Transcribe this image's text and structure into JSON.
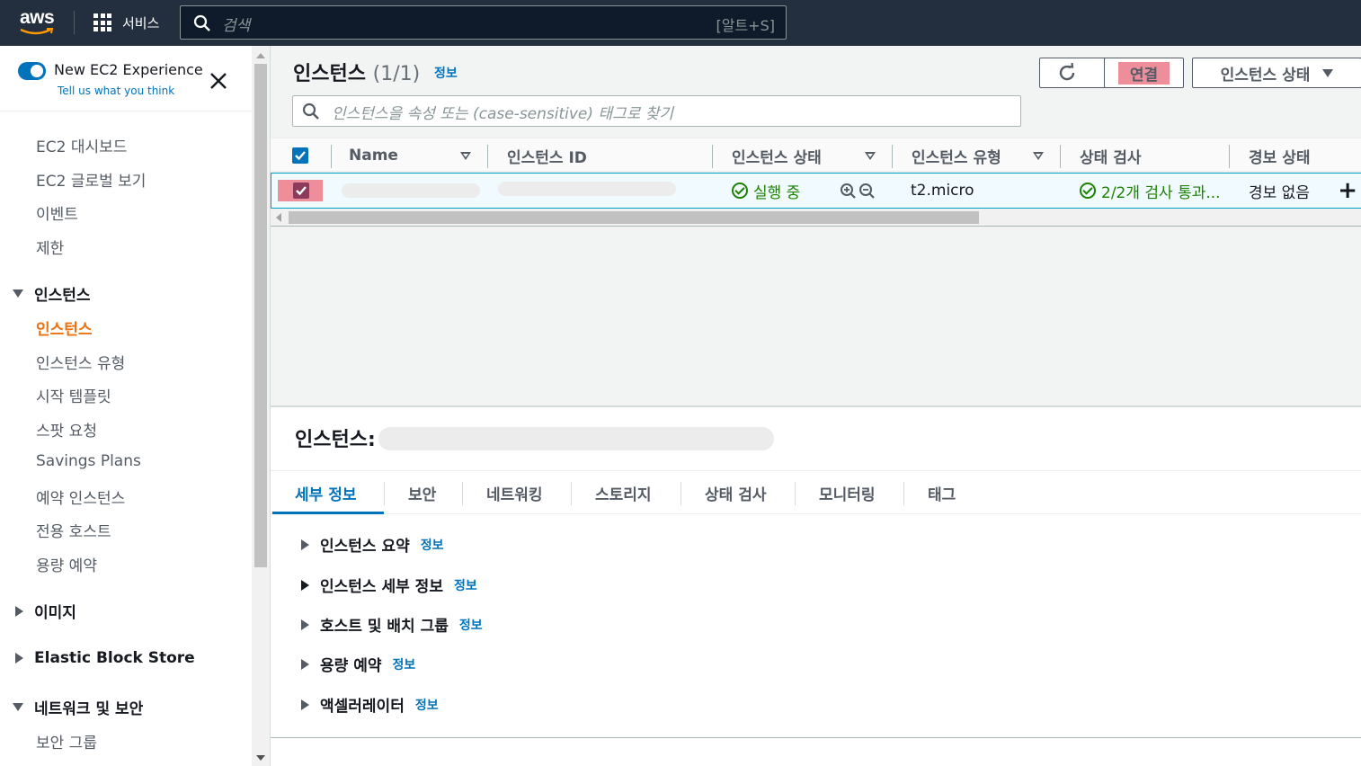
{
  "topnav": {
    "logo_text": "aws",
    "services_label": "서비스",
    "search_placeholder": "검색",
    "search_shortcut": "[알트+S]"
  },
  "sidebar": {
    "experience_title": "New EC2 Experience",
    "experience_sub": "Tell us what you think",
    "toggle_on": true,
    "items_top": [
      "EC2 대시보드",
      "EC2 글로벌 보기",
      "이벤트",
      "제한"
    ],
    "group_instances": "인스턴스",
    "instances_items": [
      "인스턴스",
      "인스턴스 유형",
      "시작 템플릿",
      "스팟 요청",
      "Savings Plans",
      "예약 인스턴스",
      "전용 호스트",
      "용량 예약"
    ],
    "active_item": "인스턴스",
    "group_images": "이미지",
    "group_ebs": "Elastic Block Store",
    "group_network": "네트워크 및 보안",
    "network_items": [
      "보안 그룹"
    ]
  },
  "main": {
    "title": "인스턴스",
    "count": "(1/1)",
    "info": "정보",
    "connect_label": "연결",
    "state_label": "인스턴스 상태",
    "filter_placeholder": "인스턴스을 속성 또는 (case-sensitive) 태그로 찾기",
    "columns": [
      "Name",
      "인스턴스 ID",
      "인스턴스 상태",
      "인스턴스 유형",
      "상태 검사",
      "경보 상태"
    ],
    "row": {
      "state": "실행 중",
      "type": "t2.micro",
      "check": "2/2개 검사 통과...",
      "alarm": "경보 없음"
    }
  },
  "detail": {
    "title": "인스턴스:",
    "tabs": [
      "세부 정보",
      "보안",
      "네트워킹",
      "스토리지",
      "상태 검사",
      "모니터링",
      "태그"
    ],
    "sections": [
      {
        "label": "인스턴스 요약",
        "info": "정보"
      },
      {
        "label": "인스턴스 세부 정보",
        "info": "정보"
      },
      {
        "label": "호스트 및 배치 그룹",
        "info": "정보"
      },
      {
        "label": "용량 예약",
        "info": "정보"
      },
      {
        "label": "액셀러레이터",
        "info": "정보"
      }
    ]
  },
  "colors": {
    "nav_bg": "#232f3e",
    "accent_blue": "#0073bb",
    "active_orange": "#ec7211",
    "running_green": "#1d8102",
    "highlight_pink": "#ee8e9a"
  }
}
